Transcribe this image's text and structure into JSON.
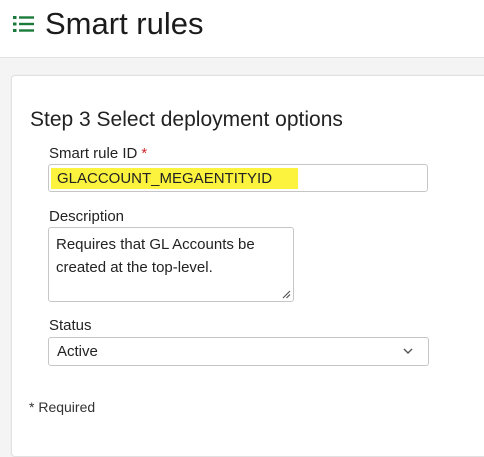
{
  "header": {
    "icon": "list-icon",
    "title": "Smart rules",
    "accent_color": "#1a7a3a"
  },
  "form": {
    "step_title": "Step 3 Select deployment options",
    "rule_id": {
      "label": "Smart rule ID",
      "required_marker": "*",
      "value": "GLACCOUNT_MEGAENTITYID",
      "highlight_color": "#fbf33e"
    },
    "description": {
      "label": "Description",
      "value": "Requires that GL Accounts be created at the top-level."
    },
    "status": {
      "label": "Status",
      "selected": "Active",
      "icon": "chevron-down-icon"
    },
    "required_note": "* Required"
  }
}
